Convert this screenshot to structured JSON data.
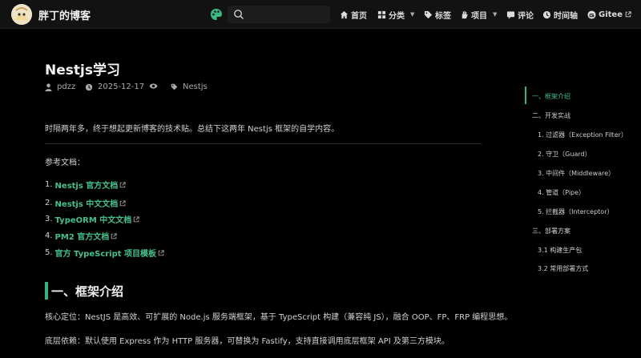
{
  "nav": {
    "site_title": "胖丁的博客",
    "search_placeholder": "",
    "items": [
      {
        "label": "首页",
        "icon": "home-icon"
      },
      {
        "label": "分类",
        "icon": "grid-icon",
        "dropdown": true
      },
      {
        "label": "标签",
        "icon": "tag-icon"
      },
      {
        "label": "项目",
        "icon": "hand-icon",
        "dropdown": true
      },
      {
        "label": "评论",
        "icon": "comment-icon"
      },
      {
        "label": "时间轴",
        "icon": "clock-icon"
      },
      {
        "label": "Gitee",
        "icon": "gitee-icon",
        "external": true
      }
    ],
    "accent": "#3cb882"
  },
  "article": {
    "title": "Nestjs学习",
    "author": "pdzz",
    "date": "2025-12-17",
    "tag": "Nestjs",
    "intro": "时隔两年多，终于想起更新博客的技术贴。总结下这两年 Nestjs 框架的自学内容。",
    "refs_heading": "参考文档：",
    "refs": [
      {
        "num": "1.",
        "label": "Nestjs 官方文档"
      },
      {
        "num": "2.",
        "label": "Nestjs 中文文档"
      },
      {
        "num": "3.",
        "label": "TypeORM 中文文档"
      },
      {
        "num": "4.",
        "label": "PM2 官方文档"
      },
      {
        "num": "5.",
        "label": "官方 TypeScript 项目模板"
      }
    ],
    "section_title": "一、框架介绍",
    "p1": "核心定位：NestJS 是高效、可扩展的 Node.js 服务端框架，基于 TypeScript 构建（兼容纯 JS），融合 OOP、FP、FRP 编程思想。",
    "p2": "底层依赖：默认使用 Express 作为 HTTP 服务器，可替换为 Fastify，支持直接调用底层框架 API 及第三方模块。"
  },
  "toc": {
    "items": [
      {
        "label": "一、框架介绍",
        "level": 1,
        "active": true
      },
      {
        "label": "二、开发实战",
        "level": 1
      },
      {
        "label": "1. 过滤器（Exception Filter）",
        "level": 2
      },
      {
        "label": "2. 守卫（Guard）",
        "level": 2
      },
      {
        "label": "3. 中间件（Middleware）",
        "level": 2
      },
      {
        "label": "4. 管道（Pipe）",
        "level": 2
      },
      {
        "label": "5. 拦截器（Interceptor）",
        "level": 2
      },
      {
        "label": "三、部署方案",
        "level": 1
      },
      {
        "label": "3.1 构建生产包",
        "level": 2
      },
      {
        "label": "3.2 常用部署方式",
        "level": 2
      }
    ]
  },
  "colors": {
    "background": "#000000",
    "navbar": "#121212",
    "accent": "#3cb882",
    "link": "#44c08c"
  }
}
